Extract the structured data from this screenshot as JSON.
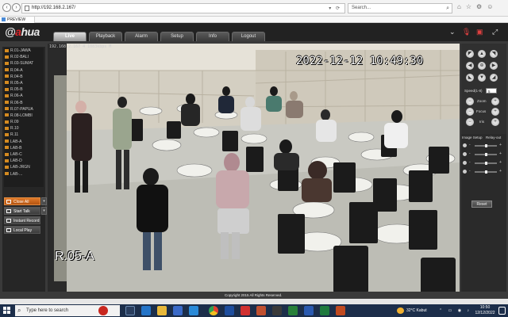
{
  "browser": {
    "url": "http://192.168.2.167/",
    "search_placeholder": "Search...",
    "tab_title": "PREVIEW"
  },
  "app": {
    "logo": "alhua",
    "menu": [
      "Live",
      "Playback",
      "Alarm",
      "Setup",
      "Info",
      "Logout"
    ],
    "active_menu": "Live"
  },
  "channels": [
    "R.01-JAWA",
    "R.02-BALI",
    "R.03-SUMAT",
    "R.04-A",
    "R.04-B",
    "R.05-A",
    "R.05-B",
    "R.06-A",
    "R.06-B",
    "R.07-PAPUA",
    "R.08-LOMBI",
    "R.09",
    "R.10",
    "R.11",
    "LAB-A",
    "LAB-B",
    "LAB-C",
    "LAB-D",
    "LAB-JRGN",
    "LAB-..."
  ],
  "left_buttons": {
    "close_all": "Close All",
    "start_talk": "Start Talk",
    "instant_record": "Instant Record",
    "local_play": "Local Play"
  },
  "video": {
    "timestamp": "2022-12-12 10:49:30",
    "camera_name": "R.05-A",
    "info_line": "192.168.2.167 4  1083kbps  M"
  },
  "ptz": {
    "speed_label": "Speed(1-8)",
    "speed_value": "5",
    "zoom": "Zoom",
    "focus": "Focus",
    "iris": "Iris"
  },
  "image_setup": {
    "title": "Image Setup",
    "relay": "Relay-out",
    "reset": "Reset",
    "levels": [
      0.5,
      0.5,
      0.5,
      0.5
    ]
  },
  "copyright": "Copyright 2015 All Rights Reserved.",
  "taskbar": {
    "search_placeholder": "Type here to search",
    "weather": "32°C  Kabut",
    "time": "10:50",
    "date": "12/12/2022"
  },
  "colors": {
    "accent": "#d8262a",
    "orange_button": "#e07a2a",
    "taskbar": "#1c2e4a"
  }
}
